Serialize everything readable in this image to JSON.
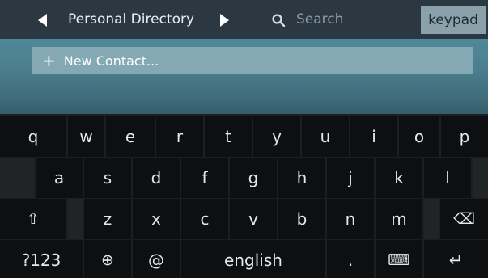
{
  "header": {
    "title": "Personal Directory",
    "search_placeholder": "Search",
    "keypad_label": "keypad"
  },
  "content": {
    "new_contact_label": "New Contact..."
  },
  "keyboard": {
    "row1": [
      "q",
      "w",
      "e",
      "r",
      "t",
      "y",
      "u",
      "i",
      "o",
      "p"
    ],
    "row2": [
      "a",
      "s",
      "d",
      "f",
      "g",
      "h",
      "j",
      "k",
      "l"
    ],
    "row3": [
      "z",
      "x",
      "c",
      "v",
      "b",
      "n",
      "m"
    ],
    "shift_symbol": "⇧",
    "backspace_symbol": "⌫",
    "numbers_label": "?123",
    "globe_symbol": "⊕",
    "at_label": "@",
    "space_label": "english",
    "period_label": ".",
    "emoji_symbol": "⌨",
    "enter_symbol": "↵"
  },
  "colors": {
    "topbar": "#2b3842",
    "keypad_button": "#8aa0ab",
    "content_gradient": "#4f8898",
    "new_contact_bar": "#85a9b4",
    "key": "#0e0f10",
    "keyboard_bg": "#1c1e1f"
  },
  "icons": [
    "left-arrow-icon",
    "right-arrow-icon",
    "search-icon",
    "plus-icon",
    "shift-icon",
    "backspace-icon",
    "globe-icon",
    "keyboard-icon",
    "enter-icon"
  ]
}
